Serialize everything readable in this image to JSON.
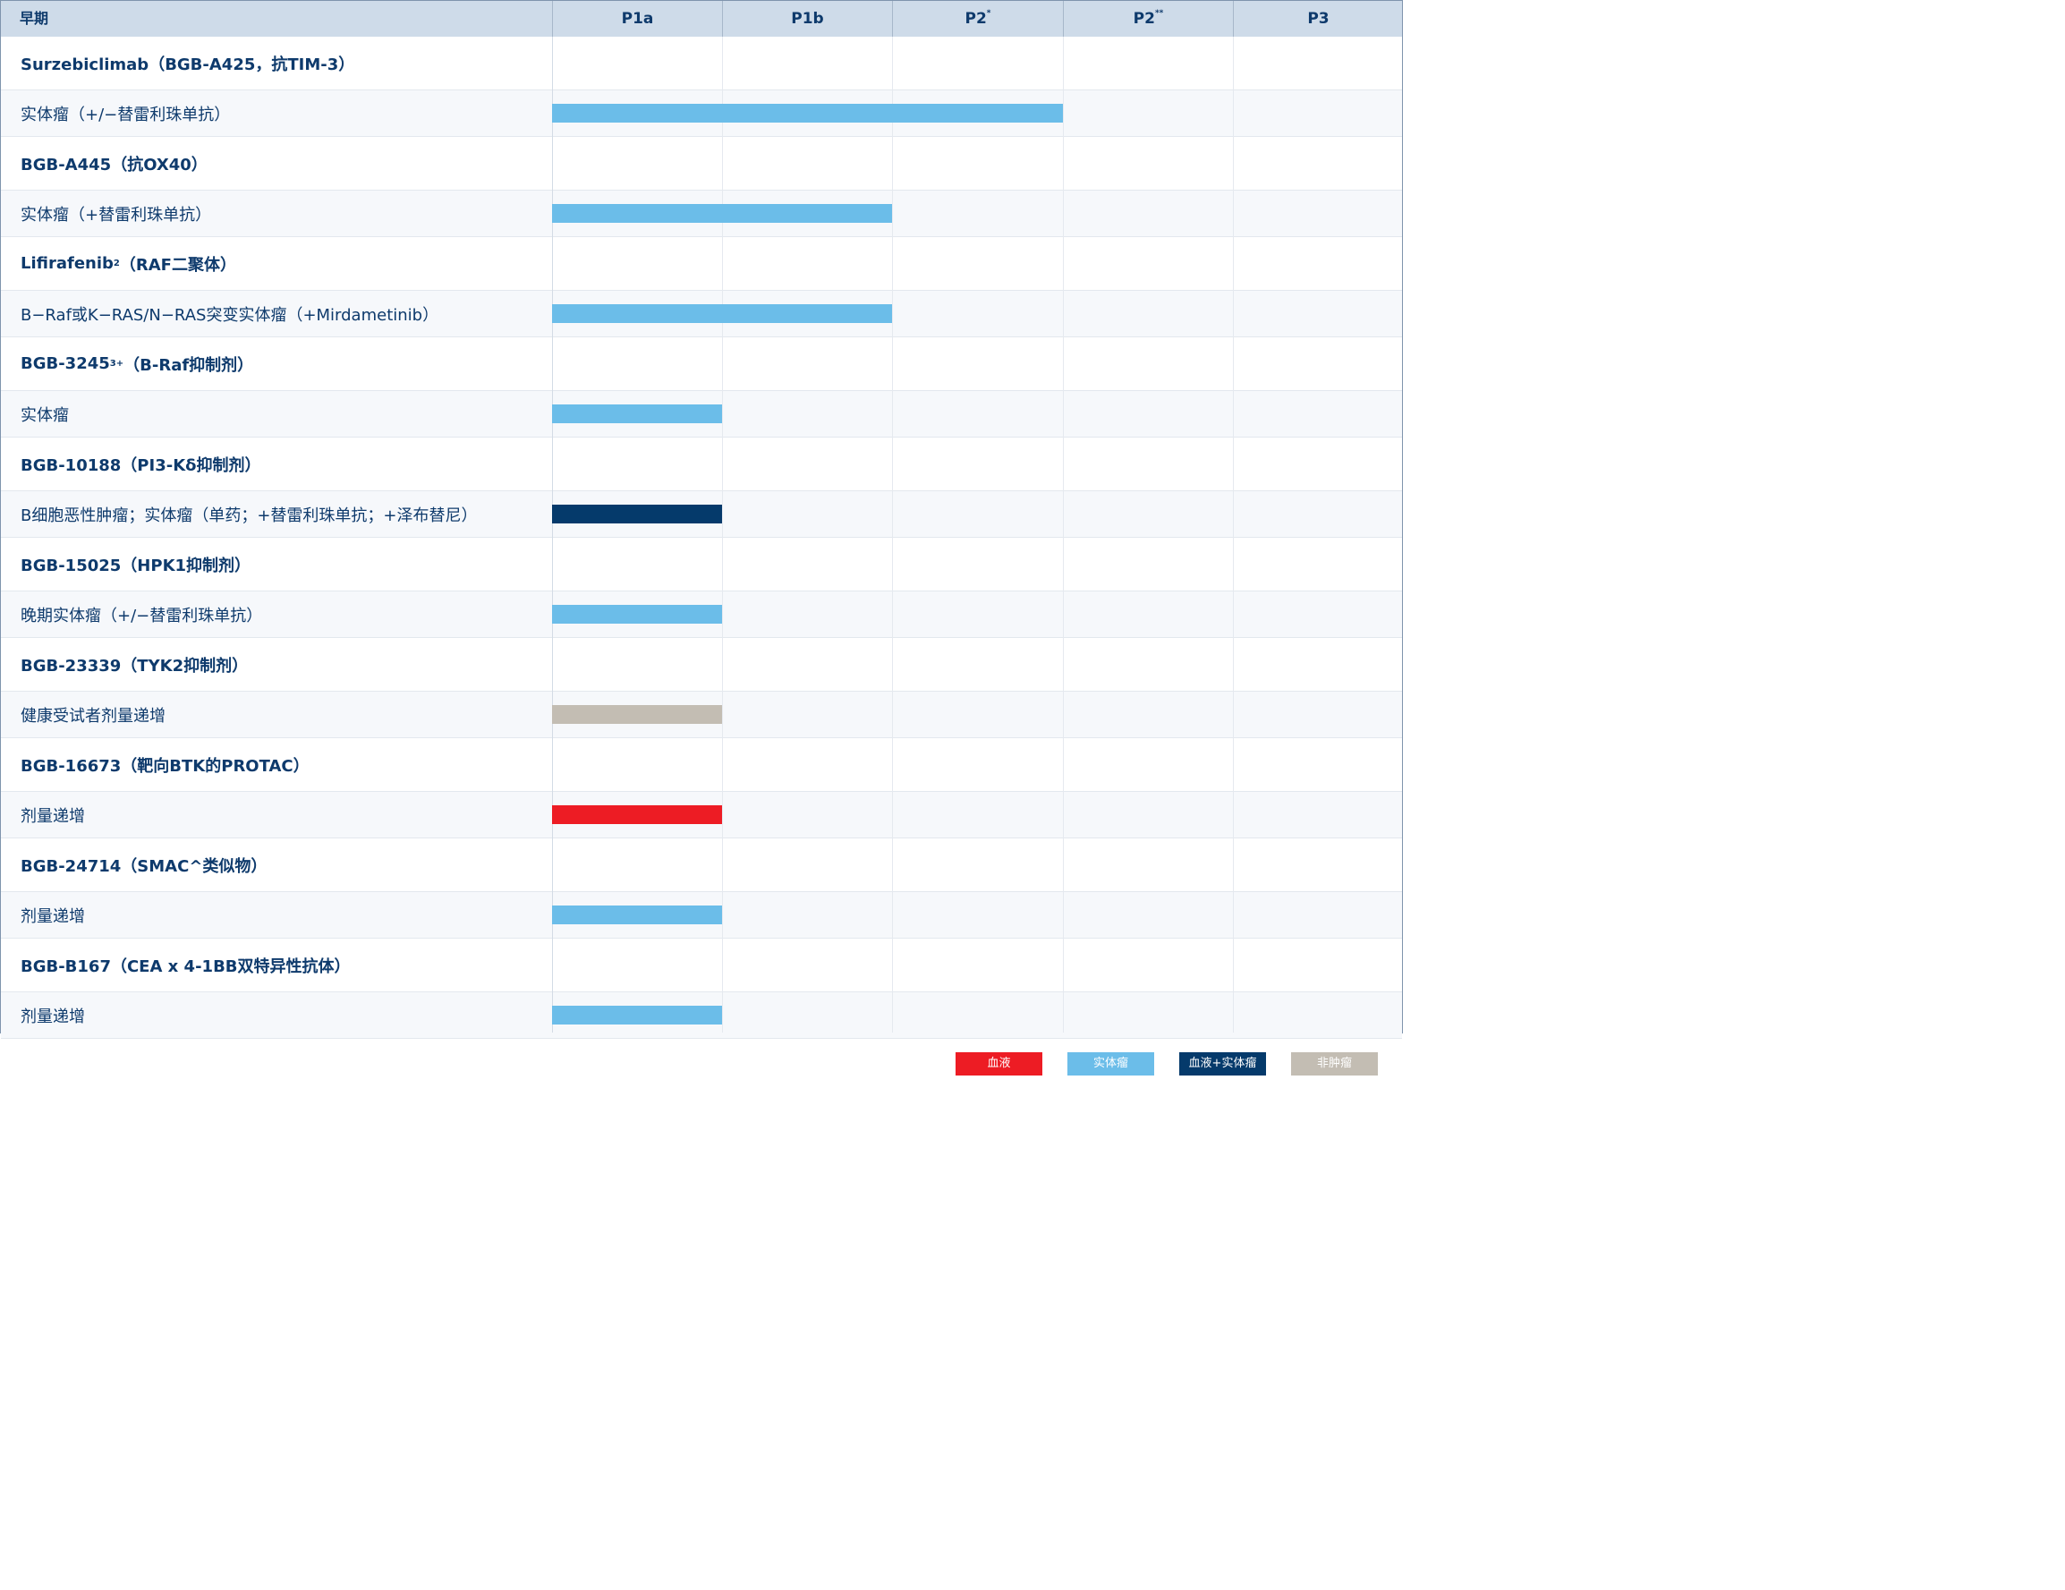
{
  "header": {
    "first_col": "早期",
    "phases": [
      {
        "name": "P1",
        "suffix": "a",
        "sup": ""
      },
      {
        "name": "P1",
        "suffix": "b",
        "sup": ""
      },
      {
        "name": "P2",
        "suffix": "",
        "sup": "*"
      },
      {
        "name": "P2",
        "suffix": "",
        "sup": "**"
      },
      {
        "name": "P3",
        "suffix": "",
        "sup": ""
      }
    ]
  },
  "colors": {
    "血液": "#ed1c24",
    "实体瘤": "#6bbde9",
    "血液+实体瘤": "#053a6b",
    "非肿瘤": "#c3bdb3"
  },
  "chart_data": {
    "type": "table",
    "phases": [
      "P1a",
      "P1b",
      "P2*",
      "P2**",
      "P3"
    ],
    "programs": [
      {
        "name": "Surzebiclimab（BGB-A425，抗TIM-3）",
        "sup": "",
        "indication": "实体瘤（+/−替雷利珠单抗）",
        "category": "实体瘤",
        "phase_reached": 3
      },
      {
        "name": "BGB-A445（抗OX40）",
        "sup": "",
        "indication": "实体瘤（+替雷利珠单抗）",
        "category": "实体瘤",
        "phase_reached": 2
      },
      {
        "name": "Lifirafenib",
        "sup": "2",
        "name_rest": "（RAF二聚体）",
        "indication": "B−Raf或K−RAS/N−RAS突变实体瘤（+Mirdametinib）",
        "category": "实体瘤",
        "phase_reached": 2
      },
      {
        "name": "BGB-3245",
        "sup": "3+",
        "name_rest": "（B-Raf抑制剂）",
        "indication": "实体瘤",
        "category": "实体瘤",
        "phase_reached": 1
      },
      {
        "name": "BGB-10188（PI3-Kδ抑制剂）",
        "sup": "",
        "indication": "B细胞恶性肿瘤；实体瘤（单药；+替雷利珠单抗；+泽布替尼）",
        "category": "血液+实体瘤",
        "phase_reached": 1
      },
      {
        "name": "BGB-15025（HPK1抑制剂）",
        "sup": "",
        "indication": "晚期实体瘤（+/−替雷利珠单抗）",
        "category": "实体瘤",
        "phase_reached": 1
      },
      {
        "name": "BGB-23339（TYK2抑制剂）",
        "sup": "",
        "indication": "健康受试者剂量递增",
        "category": "非肿瘤",
        "phase_reached": 1
      },
      {
        "name": "BGB-16673（靶向BTK的PROTAC）",
        "sup": "",
        "indication": "剂量递增",
        "category": "血液",
        "phase_reached": 1
      },
      {
        "name": "BGB-24714（SMAC^类似物）",
        "sup": "",
        "indication": "剂量递增",
        "category": "实体瘤",
        "phase_reached": 1
      },
      {
        "name": "BGB-B167（CEA x 4-1BB双特异性抗体）",
        "sup": "",
        "indication": "剂量递增",
        "category": "实体瘤",
        "phase_reached": 1
      }
    ]
  },
  "legend": [
    "血液",
    "实体瘤",
    "血液+实体瘤",
    "非肿瘤"
  ]
}
